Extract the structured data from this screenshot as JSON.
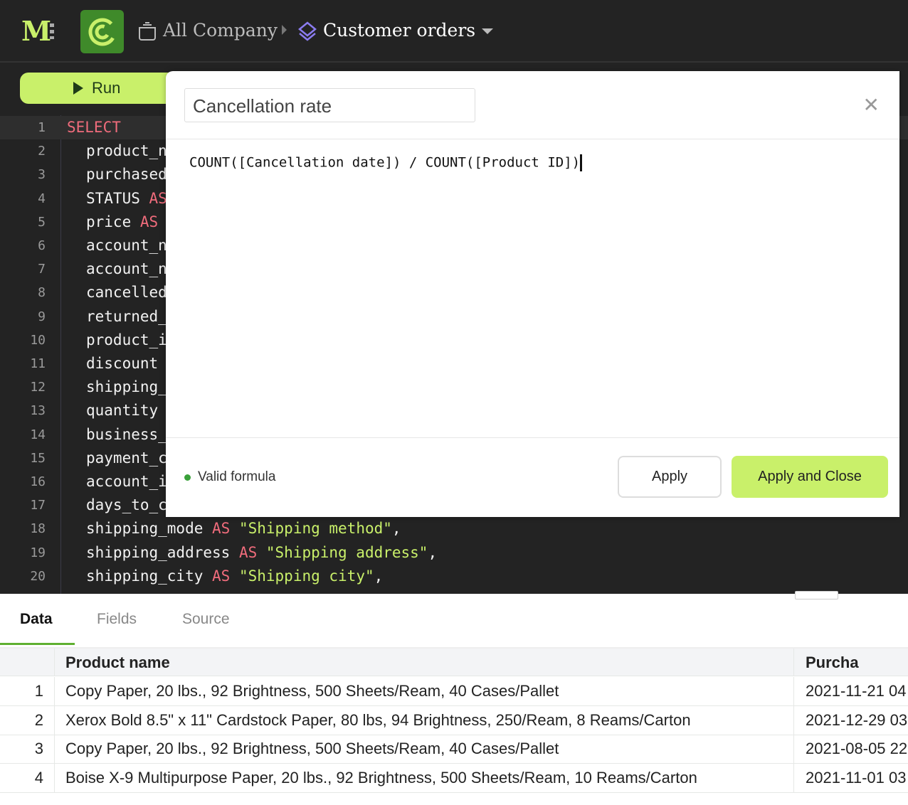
{
  "header": {
    "logo": "M",
    "breadcrumb_parent": "All Company",
    "breadcrumb_current": "Customer orders"
  },
  "editor": {
    "run_label": "Run",
    "lines": [
      {
        "n": "1",
        "parts": [
          {
            "t": "SELECT",
            "k": "kw"
          }
        ]
      },
      {
        "n": "2",
        "parts": [
          {
            "t": "product_n",
            "k": ""
          }
        ]
      },
      {
        "n": "3",
        "parts": [
          {
            "t": "purchased",
            "k": ""
          }
        ]
      },
      {
        "n": "4",
        "parts": [
          {
            "t": "STATUS ",
            "k": ""
          },
          {
            "t": "AS",
            "k": "kw"
          }
        ]
      },
      {
        "n": "5",
        "parts": [
          {
            "t": "price ",
            "k": ""
          },
          {
            "t": "AS",
            "k": "kw"
          }
        ]
      },
      {
        "n": "6",
        "parts": [
          {
            "t": "account_n",
            "k": ""
          }
        ]
      },
      {
        "n": "7",
        "parts": [
          {
            "t": "account_n",
            "k": ""
          }
        ]
      },
      {
        "n": "8",
        "parts": [
          {
            "t": "cancelled",
            "k": ""
          }
        ]
      },
      {
        "n": "9",
        "parts": [
          {
            "t": "returned_",
            "k": ""
          }
        ]
      },
      {
        "n": "10",
        "parts": [
          {
            "t": "product_i",
            "k": ""
          }
        ]
      },
      {
        "n": "11",
        "parts": [
          {
            "t": "discount",
            "k": ""
          }
        ]
      },
      {
        "n": "12",
        "parts": [
          {
            "t": "shipping_",
            "k": ""
          }
        ]
      },
      {
        "n": "13",
        "parts": [
          {
            "t": "quantity",
            "k": ""
          }
        ]
      },
      {
        "n": "14",
        "parts": [
          {
            "t": "business_",
            "k": ""
          }
        ]
      },
      {
        "n": "15",
        "parts": [
          {
            "t": "payment_c",
            "k": ""
          }
        ]
      },
      {
        "n": "16",
        "parts": [
          {
            "t": "account_i",
            "k": ""
          }
        ]
      },
      {
        "n": "17",
        "parts": [
          {
            "t": "days_to_c",
            "k": ""
          }
        ]
      },
      {
        "n": "18",
        "parts": [
          {
            "t": "shipping_mode ",
            "k": ""
          },
          {
            "t": "AS",
            "k": "kw"
          },
          {
            "t": " \"Shipping method\"",
            "k": "str"
          },
          {
            "t": ",",
            "k": ""
          }
        ]
      },
      {
        "n": "19",
        "parts": [
          {
            "t": "shipping_address ",
            "k": ""
          },
          {
            "t": "AS",
            "k": "kw"
          },
          {
            "t": " \"Shipping address\"",
            "k": "str"
          },
          {
            "t": ",",
            "k": ""
          }
        ]
      },
      {
        "n": "20",
        "parts": [
          {
            "t": "shipping_city ",
            "k": ""
          },
          {
            "t": "AS",
            "k": "kw"
          },
          {
            "t": " \"Shipping city\"",
            "k": "str"
          },
          {
            "t": ",",
            "k": ""
          }
        ]
      }
    ]
  },
  "modal": {
    "title": "Cancellation rate",
    "formula": "COUNT([Cancellation date]) / COUNT([Product ID])",
    "status": "Valid formula",
    "apply": "Apply",
    "apply_close": "Apply and Close"
  },
  "tabs": [
    "Data",
    "Fields",
    "Source"
  ],
  "table": {
    "columns": [
      "Product name",
      "Purcha"
    ],
    "rows": [
      {
        "i": "1",
        "name": "Copy Paper, 20 lbs., 92 Brightness, 500 Sheets/Ream, 40 Cases/Pallet",
        "date": "2021-11-21 04"
      },
      {
        "i": "2",
        "name": "Xerox Bold 8.5\" x 11\" Cardstock Paper, 80 lbs, 94 Brightness, 250/Ream, 8 Reams/Carton",
        "date": "2021-12-29 03"
      },
      {
        "i": "3",
        "name": "Copy Paper, 20 lbs., 92 Brightness, 500 Sheets/Ream, 40 Cases/Pallet",
        "date": "2021-08-05 22"
      },
      {
        "i": "4",
        "name": "Boise X-9 Multipurpose Paper, 20 lbs., 92 Brightness, 500 Sheets/Ream, 10 Reams/Carton",
        "date": "2021-11-01 03"
      }
    ]
  }
}
